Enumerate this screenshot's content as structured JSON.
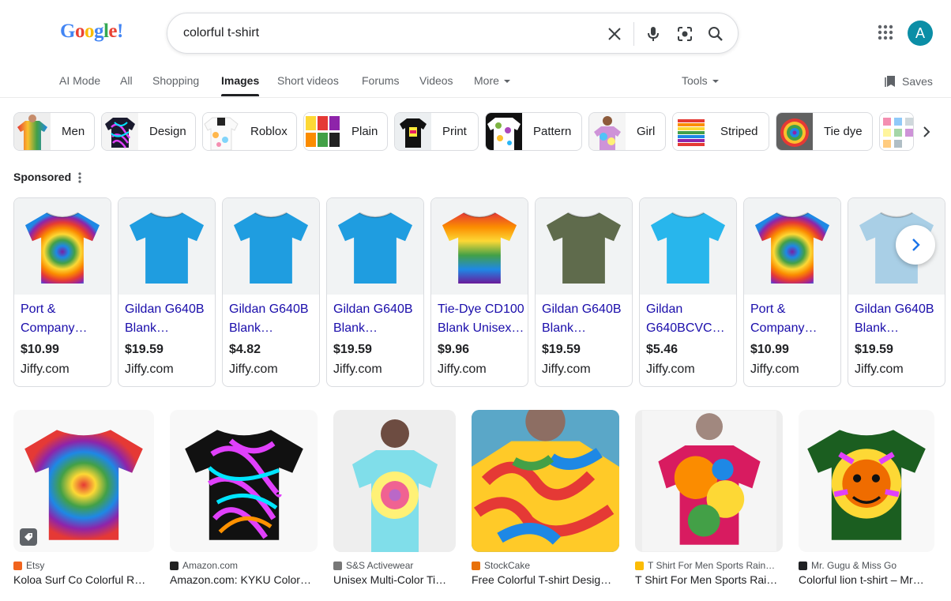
{
  "logo": {
    "letters": [
      "G",
      "o",
      "o",
      "g",
      "l",
      "e",
      "!"
    ],
    "colors": [
      "#4285f4",
      "#ea4335",
      "#fbbc05",
      "#4285f4",
      "#34a853",
      "#ea4335",
      "#4285f4"
    ]
  },
  "search": {
    "query": "colorful t-shirt",
    "icons": [
      "close-icon",
      "mic-icon",
      "lens-icon",
      "search-icon"
    ]
  },
  "header": {
    "avatar_letter": "A",
    "avatar_color": "#0b8ea6"
  },
  "tabs": [
    "AI Mode",
    "All",
    "Shopping",
    "Images",
    "Short videos",
    "Forums",
    "Videos",
    "More"
  ],
  "active_tab": "Images",
  "tools_label": "Tools",
  "saves_label": "Saves",
  "chips": [
    {
      "label": "Men"
    },
    {
      "label": "Design"
    },
    {
      "label": "Roblox"
    },
    {
      "label": "Plain"
    },
    {
      "label": "Print"
    },
    {
      "label": "Pattern"
    },
    {
      "label": "Girl"
    },
    {
      "label": "Striped"
    },
    {
      "label": "Tie dye"
    }
  ],
  "sponsored_label": "Sponsored",
  "products": [
    {
      "title": "Port & Company…",
      "price": "$10.99",
      "store": "Jiffy.com",
      "shirt": "tiedye"
    },
    {
      "title": "Gildan G640B Blank…",
      "price": "$19.59",
      "store": "Jiffy.com",
      "shirt": "#1f9de0"
    },
    {
      "title": "Gildan G640B Blank…",
      "price": "$4.82",
      "store": "Jiffy.com",
      "shirt": "#1f9de0"
    },
    {
      "title": "Gildan G640B Blank…",
      "price": "$19.59",
      "store": "Jiffy.com",
      "shirt": "#1f9de0"
    },
    {
      "title": "Tie-Dye CD100 Blank Unisex…",
      "price": "$9.96",
      "store": "Jiffy.com",
      "shirt": "rainbow"
    },
    {
      "title": "Gildan G640B Blank…",
      "price": "$19.59",
      "store": "Jiffy.com",
      "shirt": "#5f6b4c"
    },
    {
      "title": "Gildan G640BCVC…",
      "price": "$5.46",
      "store": "Jiffy.com",
      "shirt": "#28b6ec"
    },
    {
      "title": "Port & Company…",
      "price": "$10.99",
      "store": "Jiffy.com",
      "shirt": "tiedye"
    },
    {
      "title": "Gildan G640B Blank…",
      "price": "$19.59",
      "store": "Jiffy.com",
      "shirt": "#a9cfe6"
    }
  ],
  "results": [
    {
      "source": "Etsy",
      "title": "Koloa Surf Co Colorful R…",
      "favicon": "#f1641e"
    },
    {
      "source": "Amazon.com",
      "title": "Amazon.com: KYKU Color…",
      "favicon": "#222222"
    },
    {
      "source": "S&S Activewear",
      "title": "Unisex Multi-Color Ti…",
      "favicon": "#777777"
    },
    {
      "source": "StockCake",
      "title": "Free Colorful T-shirt Desig…",
      "favicon": "#e8710a"
    },
    {
      "source": "T Shirt For Men Sports Rain…",
      "title": "T Shirt For Men Sports Rai…",
      "favicon": "#fbbc05"
    },
    {
      "source": "Mr. Gugu & Miss Go",
      "title": "Colorful lion t-shirt – Mr…",
      "favicon": "#202124"
    }
  ]
}
